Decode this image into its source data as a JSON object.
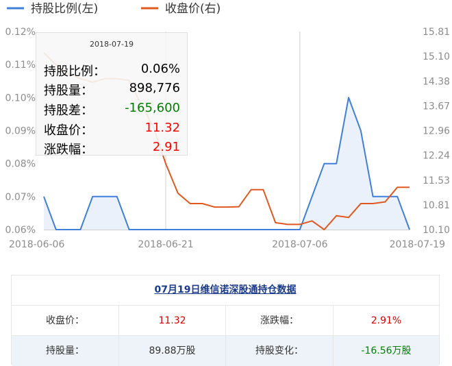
{
  "chart_data": {
    "type": "line",
    "legend": [
      {
        "name": "持股比例(左)",
        "color": "#3f7fd9"
      },
      {
        "name": "收盘价(右)",
        "color": "#e1581f"
      }
    ],
    "legend_position": "top-left",
    "x_ticks": [
      "2018-06-06",
      "2018-06-21",
      "2018-07-06",
      "2018-07-19"
    ],
    "y_left": {
      "ticks": [
        "0.12%",
        "0.11%",
        "0.10%",
        "0.09%",
        "0.08%",
        "0.07%",
        "0.06%"
      ],
      "range": [
        0.06,
        0.12
      ],
      "unit": "%"
    },
    "y_right": {
      "ticks": [
        "15.81",
        "15.10",
        "14.38",
        "13.67",
        "12.96",
        "12.24",
        "11.53",
        "10.81",
        "10.10"
      ],
      "range": [
        10.1,
        15.81
      ]
    },
    "grid": "vertical lines at labelled x ticks",
    "dates": [
      "2018-06-06",
      "2018-06-07",
      "2018-06-08",
      "2018-06-11",
      "2018-06-12",
      "2018-06-13",
      "2018-06-14",
      "2018-06-15",
      "2018-06-19",
      "2018-06-20",
      "2018-06-21",
      "2018-06-22",
      "2018-06-25",
      "2018-06-26",
      "2018-06-27",
      "2018-06-28",
      "2018-06-29",
      "2018-07-02",
      "2018-07-03",
      "2018-07-04",
      "2018-07-05",
      "2018-07-06",
      "2018-07-09",
      "2018-07-10",
      "2018-07-11",
      "2018-07-12",
      "2018-07-13",
      "2018-07-16",
      "2018-07-17",
      "2018-07-18",
      "2018-07-19"
    ],
    "series": [
      {
        "name": "持股比例(左)",
        "axis": "left",
        "color": "#3f7fd9",
        "area": true,
        "values": [
          0.07,
          0.06,
          0.06,
          0.06,
          0.07,
          0.07,
          0.07,
          0.06,
          0.06,
          0.06,
          0.06,
          0.06,
          0.06,
          0.06,
          0.06,
          0.06,
          0.06,
          0.06,
          0.06,
          0.06,
          0.06,
          0.06,
          0.07,
          0.08,
          0.08,
          0.1,
          0.09,
          0.07,
          0.07,
          0.07,
          0.06
        ]
      },
      {
        "name": "收盘价(右)",
        "axis": "right",
        "color": "#e1581f",
        "area": false,
        "values": [
          15.2,
          14.85,
          14.6,
          14.45,
          14.35,
          14.45,
          14.45,
          14.4,
          13.7,
          13.05,
          12.0,
          11.15,
          10.85,
          10.85,
          10.75,
          10.75,
          10.76,
          11.25,
          11.25,
          10.3,
          10.25,
          10.25,
          10.35,
          10.1,
          10.5,
          10.45,
          10.85,
          10.85,
          10.9,
          11.32,
          11.32
        ]
      }
    ],
    "tooltip_index": 30
  },
  "tooltip": {
    "date": "2018-07-19",
    "rows": [
      {
        "label": "持股比例：",
        "value": "0.06%",
        "color": "#000000"
      },
      {
        "label": "持股量：",
        "value": "898,776",
        "color": "#000000"
      },
      {
        "label": "持股差：",
        "value": "-165,600",
        "color": "#008000"
      },
      {
        "label": "收盘价：",
        "value": "11.32",
        "color": "#ff0000"
      },
      {
        "label": "涨跌幅：",
        "value": "2.91",
        "color": "#ff0000"
      }
    ]
  },
  "table": {
    "title": "07月19日维信诺深股通持仓数据",
    "row1": {
      "label1": "收盘价：",
      "value1": "11.32",
      "label2": "涨跌幅：",
      "value2": "2.91%"
    },
    "row2": {
      "label1": "持股量：",
      "value1": "89.88万股",
      "label2": "持股变化：",
      "value2": "-16.56万股"
    }
  }
}
